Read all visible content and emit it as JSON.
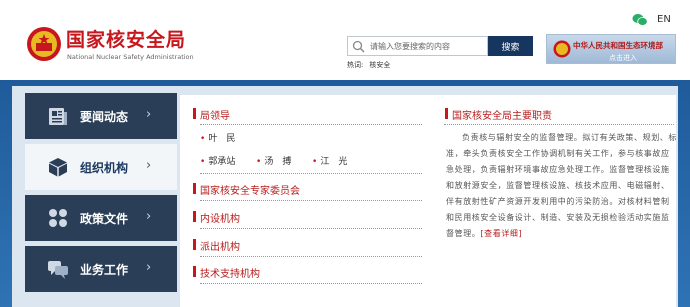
{
  "header": {
    "logo_cn": "国家核安全局",
    "logo_en": "National Nuclear Safety Administration",
    "lang_label": "EN",
    "search": {
      "placeholder": "请输入您要搜索的内容",
      "button_label": "搜索"
    },
    "hot": {
      "label": "热词:",
      "items": [
        "核安全"
      ]
    },
    "mee_banner": {
      "title": "中华人民共和国生态环境部",
      "sub": "点击进入"
    }
  },
  "nav": {
    "items": [
      {
        "label": "要闻动态",
        "icon": "news-icon"
      },
      {
        "label": "组织机构",
        "icon": "cube-icon",
        "active": true
      },
      {
        "label": "政策文件",
        "icon": "clover-icon"
      },
      {
        "label": "业务工作",
        "icon": "chat-icon"
      }
    ],
    "chevron": "›"
  },
  "content": {
    "leaders_title": "局领导",
    "leaders_row1": [
      "叶　民"
    ],
    "leaders_row2": [
      "郭承站",
      "汤　搏",
      "江　光"
    ],
    "sections": [
      "国家核安全专家委员会",
      "内设机构",
      "派出机构",
      "技术支持机构"
    ],
    "resp_title": "国家核安全局主要职责",
    "resp_text": "负责核与辐射安全的监督管理。拟订有关政策、规划、标准，牵头负责核安全工作协调机制有关工作，参与核事故应急处理，负责辐射环境事故应急处理工作。监督管理核设施和放射源安全，监督管理核设施、核技术应用、电磁辐射、伴有放射性矿产资源开发利用中的污染防治。对核材料管制和民用核安全设备设计、制造、安装及无损检验活动实施监督管理。",
    "resp_more": "[查看详细]"
  },
  "colors": {
    "brand_red": "#c8161d",
    "nav_dark": "#2a3e57",
    "band_blue": "#2f73b5",
    "search_btn": "#16365f"
  }
}
